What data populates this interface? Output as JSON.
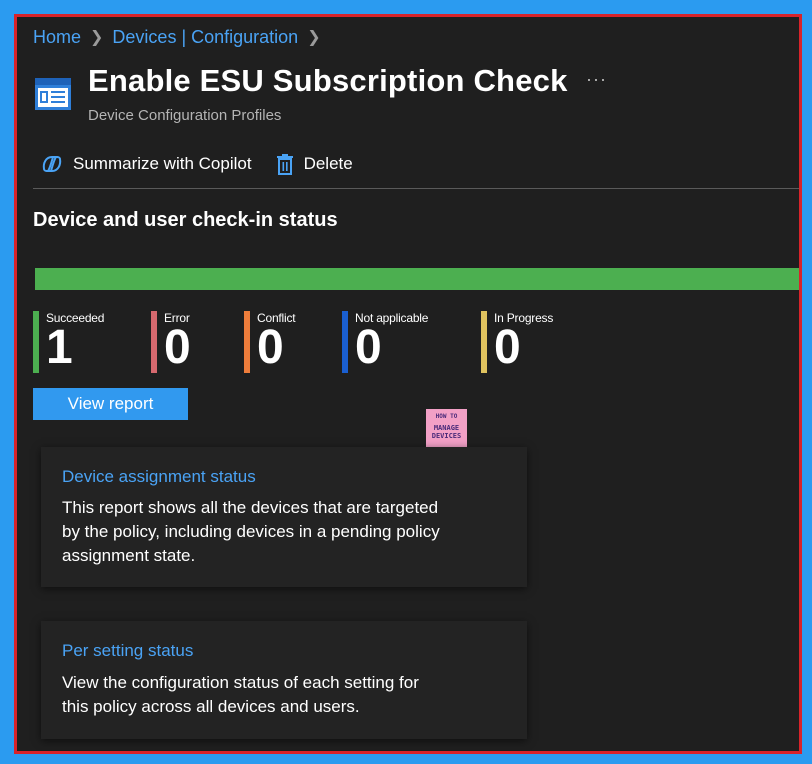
{
  "breadcrumb": [
    {
      "label": "Home"
    },
    {
      "label": "Devices | Configuration"
    }
  ],
  "header": {
    "title": "Enable ESU Subscription Check",
    "subtitle": "Device Configuration Profiles",
    "more_label": "···",
    "icon": "configuration-profile-icon"
  },
  "toolbar": {
    "copilot_label": "Summarize with Copilot",
    "copilot_icon": "copilot-icon",
    "delete_label": "Delete",
    "delete_icon": "trash-icon"
  },
  "checkin": {
    "title": "Device and user check-in status",
    "progress_succeeded_fraction": 1.0,
    "stats": [
      {
        "label": "Succeeded",
        "value": "1",
        "color": "#4caf50"
      },
      {
        "label": "Error",
        "value": "0",
        "color": "#d6696f"
      },
      {
        "label": "Conflict",
        "value": "0",
        "color": "#ee7d3b"
      },
      {
        "label": "Not applicable",
        "value": "0",
        "color": "#1a5fd1"
      },
      {
        "label": "In Progress",
        "value": "0",
        "color": "#e0c35f"
      }
    ],
    "view_report_label": "View report"
  },
  "watermark": {
    "line1": "HOW TO",
    "line2": "MANAGE",
    "line3": "DEVICES"
  },
  "cards": [
    {
      "title": "Device assignment status",
      "description": "This report shows all the devices that are targeted by the policy, including devices in a pending policy assignment state."
    },
    {
      "title": "Per setting status",
      "description": "View the configuration status of each setting for this policy across all devices and users."
    }
  ],
  "colors": {
    "accent": "#3199ef",
    "link": "#4aa3f5",
    "background": "#1f1f1f",
    "frame": "#d8232a",
    "outer": "#2b9bf0"
  }
}
